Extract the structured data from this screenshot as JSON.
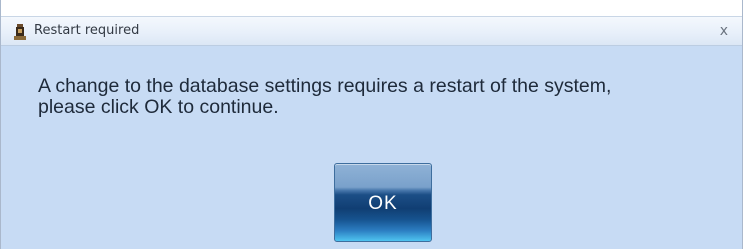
{
  "window": {
    "title": "Restart required",
    "close_glyph": "x",
    "icon": "app-icon"
  },
  "message": {
    "line1": "A change to the database settings requires a restart of the system,",
    "line2": "please click OK to continue."
  },
  "buttons": {
    "ok_label": "OK"
  }
}
